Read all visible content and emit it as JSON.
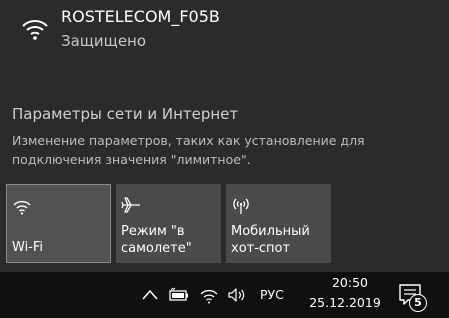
{
  "network": {
    "ssid": "ROSTELECOM_F05B",
    "status": "Защищено"
  },
  "settings": {
    "title": "Параметры сети и Интернет",
    "description": "Изменение параметров, таких как установление для подключения значения \"лимитное\"."
  },
  "tiles": [
    {
      "label": "Wi-Fi",
      "icon": "wifi-icon",
      "active": true
    },
    {
      "label": "Режим \"в\nсамолете\"",
      "icon": "airplane-icon",
      "active": false
    },
    {
      "label": "Мобильный\nхот-спот",
      "icon": "hotspot-icon",
      "active": false
    }
  ],
  "taskbar": {
    "language": "РУС",
    "time": "20:50",
    "date": "25.12.2019",
    "notification_count": "5"
  },
  "colors": {
    "flyout_bg": "#2b2b2b",
    "tile_bg": "#4a4a4a",
    "taskbar_bg": "#101010"
  }
}
